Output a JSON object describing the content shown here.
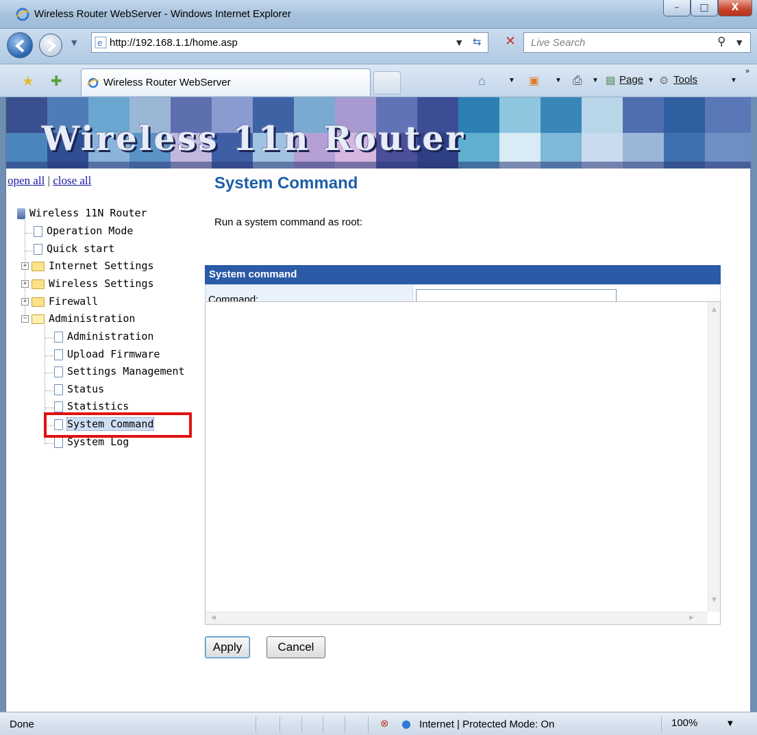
{
  "window": {
    "title": "Wireless Router WebServer - Windows Internet Explorer",
    "minimize": "–",
    "maximize": "□",
    "close": "X"
  },
  "navigation": {
    "url": "http://192.168.1.1/home.asp",
    "search_placeholder": "Live Search"
  },
  "tabs": {
    "active_label": "Wireless Router WebServer"
  },
  "command_bar": {
    "page": "Page",
    "tools": "Tools"
  },
  "banner": {
    "title": "Wireless 11n Router"
  },
  "tree_controls": {
    "open_all": "open all",
    "separator": " | ",
    "close_all": "close all"
  },
  "tree": {
    "root": "Wireless 11N Router",
    "items": [
      {
        "label": "Operation Mode",
        "type": "page",
        "level": 1
      },
      {
        "label": "Quick start",
        "type": "page",
        "level": 1
      },
      {
        "label": "Internet Settings",
        "type": "folder",
        "level": 1,
        "expanded": false
      },
      {
        "label": "Wireless Settings",
        "type": "folder",
        "level": 1,
        "expanded": false
      },
      {
        "label": "Firewall",
        "type": "folder",
        "level": 1,
        "expanded": false
      },
      {
        "label": "Administration",
        "type": "folder",
        "level": 1,
        "expanded": true
      },
      {
        "label": "Administration",
        "type": "page",
        "level": 2
      },
      {
        "label": "Upload Firmware",
        "type": "page",
        "level": 2
      },
      {
        "label": "Settings Management",
        "type": "page",
        "level": 2
      },
      {
        "label": "Status",
        "type": "page",
        "level": 2
      },
      {
        "label": "Statistics",
        "type": "page",
        "level": 2
      },
      {
        "label": "System Command",
        "type": "page",
        "level": 2,
        "selected": true
      },
      {
        "label": "System Log",
        "type": "page",
        "level": 2
      }
    ]
  },
  "content": {
    "title": "System Command",
    "description": "Run a system command as root:",
    "table_header": "System command",
    "command_label": "Command:",
    "command_value": "",
    "output_value": "",
    "apply": "Apply",
    "cancel": "Cancel"
  },
  "status": {
    "text": "Done",
    "zone": "Internet | Protected Mode: On",
    "zoom": "100%"
  },
  "colors": {
    "accent_blue": "#1c5fa8",
    "table_header": "#2b5ba6",
    "highlight_red": "#e01010"
  }
}
